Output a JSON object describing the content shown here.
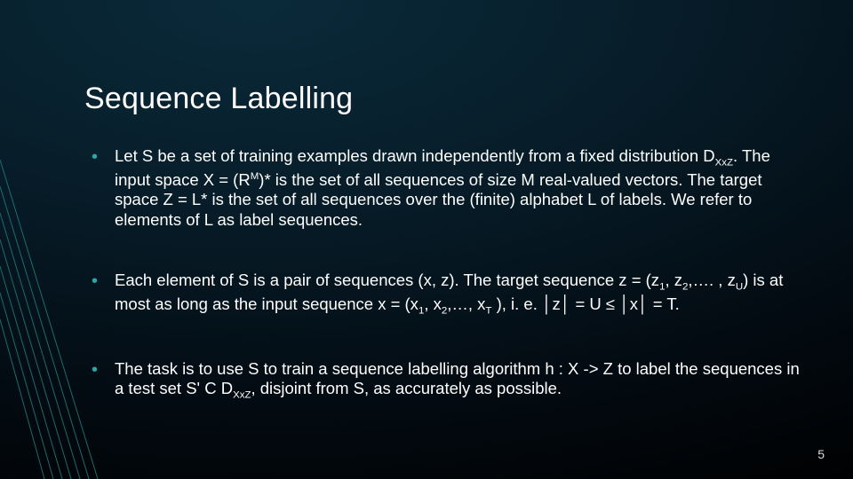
{
  "slide": {
    "title": "Sequence Labelling",
    "bullets": [
      {
        "parts": [
          {
            "t": "Let S be a set of training examples drawn independently from a fixed distribution D"
          },
          {
            "t": "XxZ",
            "cls": "sub"
          },
          {
            "t": ". The input space X = (R"
          },
          {
            "t": "M",
            "cls": "sup"
          },
          {
            "t": ")* is the set of all sequences of size M real-valued vectors. The target space Z = L* is the set of all sequences over the (finite) alphabet L of labels. We refer to elements of L as label sequences."
          }
        ]
      },
      {
        "parts": [
          {
            "t": "Each element of S is a pair of sequences (x, z). The target sequence z = (z"
          },
          {
            "t": "1",
            "cls": "sub"
          },
          {
            "t": ", z"
          },
          {
            "t": "2",
            "cls": "sub"
          },
          {
            "t": ",…. , z"
          },
          {
            "t": "U",
            "cls": "sub"
          },
          {
            "t": ") is at most as long as the input sequence x = (x"
          },
          {
            "t": "1",
            "cls": "sub"
          },
          {
            "t": ", x"
          },
          {
            "t": "2",
            "cls": "sub"
          },
          {
            "t": ",…, x"
          },
          {
            "t": "T",
            "cls": "sub"
          },
          {
            "t": " ),              i. e. │z│ = U ≤ │x│ = T."
          }
        ]
      },
      {
        "parts": [
          {
            "t": "The task is to use S to train a sequence labelling algorithm h : X -> Z to label the sequences in a test set S' C D"
          },
          {
            "t": "XxZ",
            "cls": "sub"
          },
          {
            "t": ", disjoint from S, as accurately as possible."
          }
        ]
      }
    ],
    "page_number": "5",
    "accent_color": "#2ea6a6"
  }
}
